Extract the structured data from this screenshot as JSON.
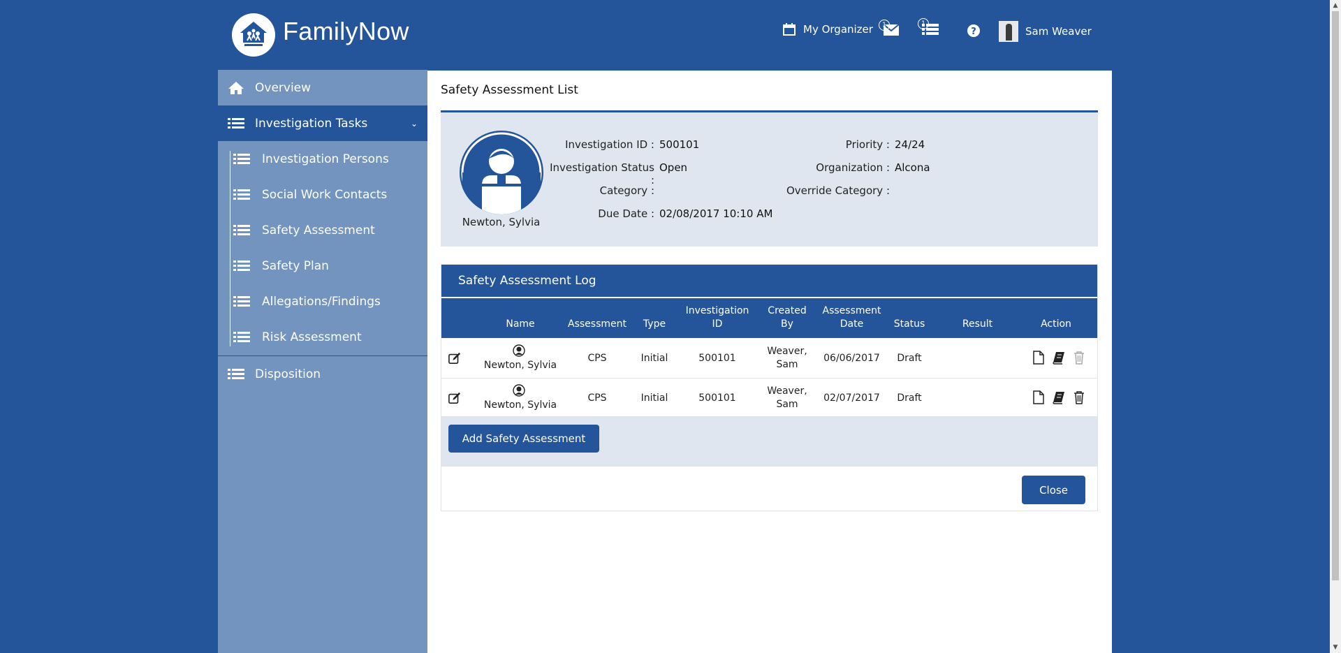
{
  "header": {
    "brand": "FamilyNow",
    "organizer_label": "My Organizer",
    "mail_badge": "1",
    "list_badge": "1",
    "help_icon": "question-circle-icon",
    "user_name": "Sam Weaver"
  },
  "sidebar": {
    "items": [
      {
        "label": "Overview",
        "icon": "home-icon"
      },
      {
        "label": "Investigation Tasks",
        "icon": "list-icon"
      },
      {
        "label": "Investigation Persons",
        "icon": "list-icon"
      },
      {
        "label": "Social Work Contacts",
        "icon": "list-icon"
      },
      {
        "label": "Safety Assessment",
        "icon": "list-icon"
      },
      {
        "label": "Safety Plan",
        "icon": "list-icon"
      },
      {
        "label": "Allegations/Findings",
        "icon": "list-icon"
      },
      {
        "label": "Risk Assessment",
        "icon": "list-icon"
      },
      {
        "label": "Disposition",
        "icon": "list-icon"
      }
    ]
  },
  "main": {
    "title": "Safety Assessment List",
    "person": {
      "name": "Newton, Sylvia",
      "fields_left": [
        {
          "label": "Investigation ID :",
          "value": "500101"
        },
        {
          "label": "Investigation Status :",
          "value": "Open"
        },
        {
          "label": "Category :",
          "value": ""
        },
        {
          "label": "Due Date :",
          "value": "02/08/2017 10:10 AM"
        }
      ],
      "fields_right": [
        {
          "label": "Priority :",
          "value": "24/24"
        },
        {
          "label": "Organization :",
          "value": "Alcona"
        },
        {
          "label": "Override Category :",
          "value": ""
        }
      ]
    },
    "log": {
      "title": "Safety Assessment Log",
      "columns": [
        "Name",
        "Assessment",
        "Type",
        "Investigation ID",
        "Created By",
        "Assessment Date",
        "Status",
        "Result",
        "Action"
      ],
      "columns_wrapped": {
        "investigation_id": [
          "Investigation",
          "ID"
        ],
        "created_by": [
          "Created",
          "By"
        ],
        "assessment_date": [
          "Assessment",
          "Date"
        ]
      },
      "rows": [
        {
          "name": "Newton, Sylvia",
          "assessment": "CPS",
          "type": "Initial",
          "investigation_id": "500101",
          "created_by_1": "Weaver,",
          "created_by_2": "Sam",
          "date": "06/06/2017",
          "status": "Draft",
          "result": "",
          "delete_enabled": false
        },
        {
          "name": "Newton, Sylvia",
          "assessment": "CPS",
          "type": "Initial",
          "investigation_id": "500101",
          "created_by_1": "Weaver,",
          "created_by_2": "Sam",
          "date": "02/07/2017",
          "status": "Draft",
          "result": "",
          "delete_enabled": true
        }
      ],
      "add_button": "Add Safety Assessment"
    },
    "close_button": "Close"
  },
  "colors": {
    "primary": "#24559a",
    "sidebar": "#7294bf",
    "card": "#dfe6ef"
  }
}
